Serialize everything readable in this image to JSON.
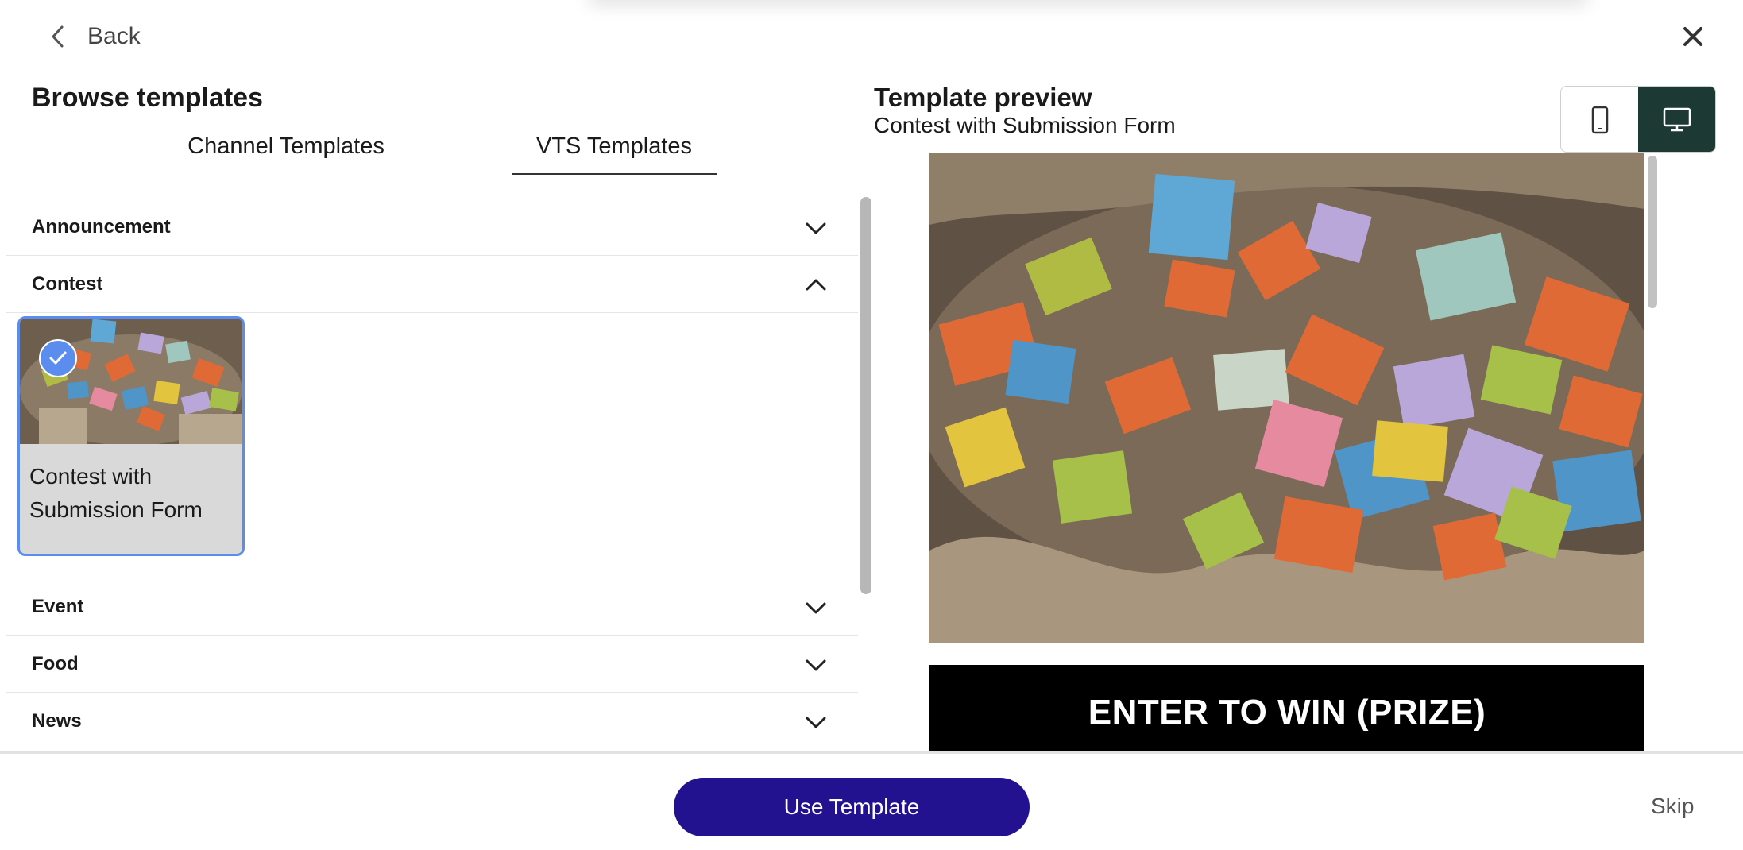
{
  "header": {
    "back_label": "Back"
  },
  "left": {
    "title": "Browse templates",
    "tabs": [
      {
        "label": "Channel Templates",
        "active": false
      },
      {
        "label": "VTS Templates",
        "active": true
      }
    ],
    "categories": [
      {
        "label": "Announcement",
        "expanded": false
      },
      {
        "label": "Contest",
        "expanded": true
      },
      {
        "label": "Event",
        "expanded": false
      },
      {
        "label": "Food",
        "expanded": false
      },
      {
        "label": "News",
        "expanded": false
      }
    ],
    "contest_card": {
      "title": "Contest with Submission Form",
      "selected": true
    }
  },
  "preview": {
    "title": "Template preview",
    "subtitle": "Contest with Submission Form",
    "banner_text": "ENTER TO WIN  (PRIZE)",
    "device_options": [
      "mobile-icon",
      "desktop-icon"
    ],
    "active_device": "desktop"
  },
  "footer": {
    "use_label": "Use Template",
    "skip_label": "Skip"
  },
  "colors": {
    "primary": "#23128f",
    "selection": "#5b8def",
    "device_active": "#1c3a33"
  }
}
